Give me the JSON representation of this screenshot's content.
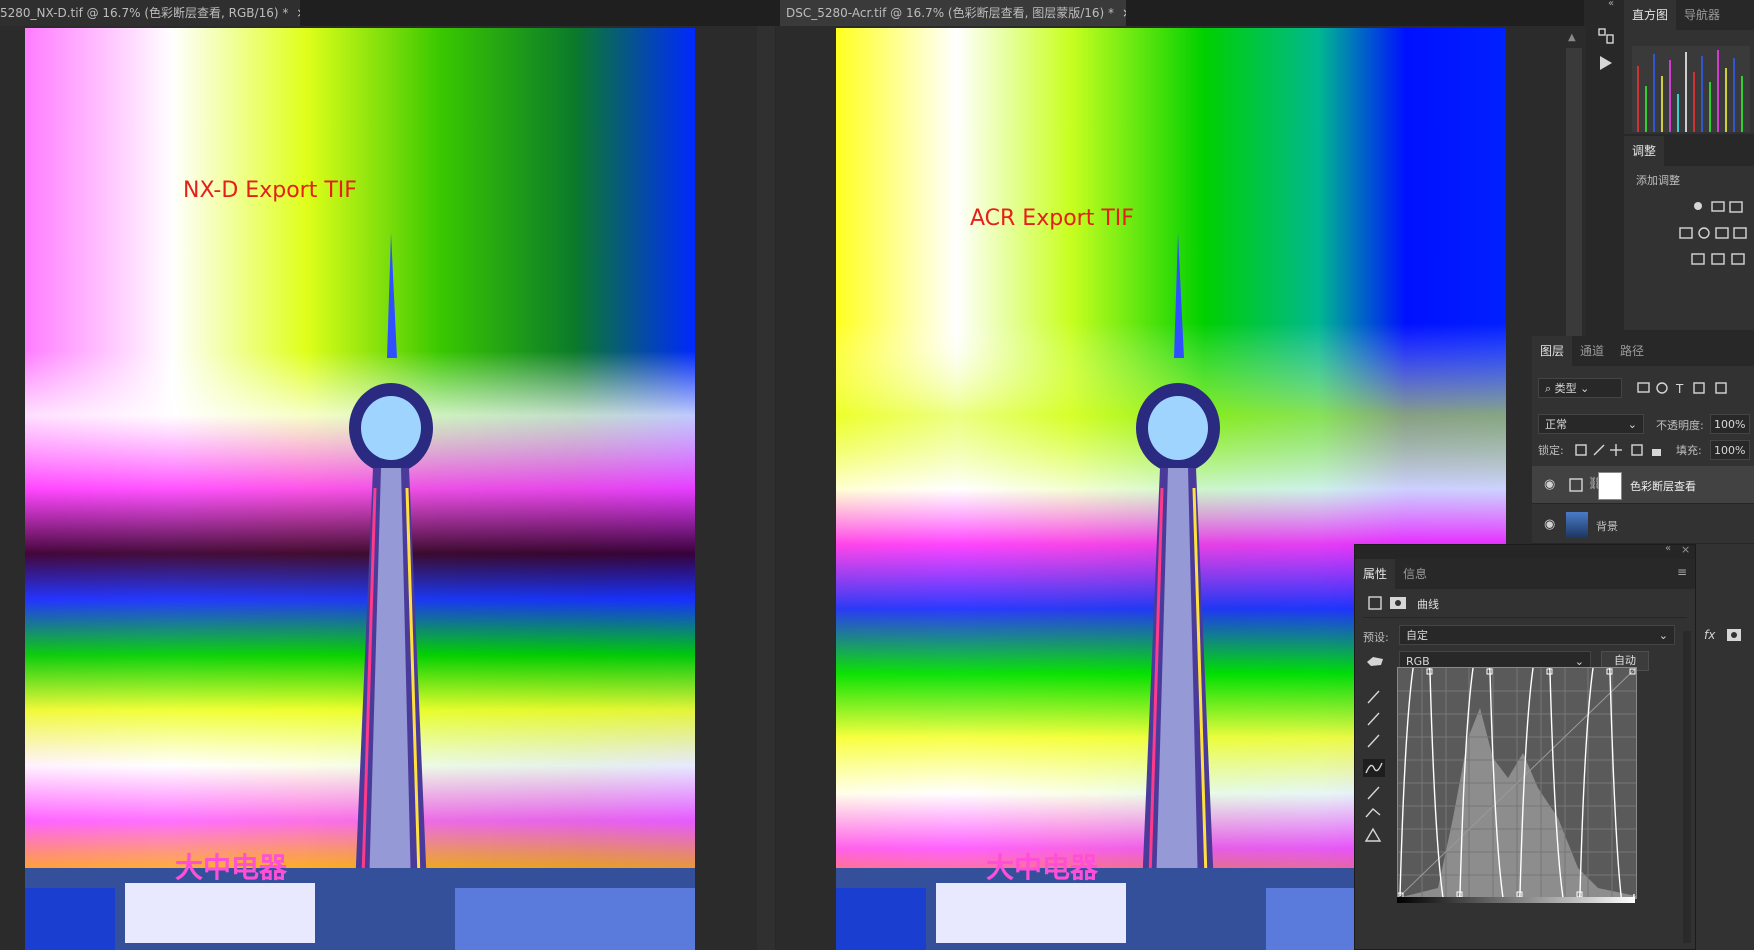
{
  "tabs": [
    {
      "title": "5280_NX-D.tif @ 16.7% (色彩断层查看, RGB/16) *",
      "close": "×"
    },
    {
      "title": "DSC_5280-Acr.tif @ 16.7% (色彩断层查看, 图层蒙版/16) *",
      "close": "×"
    }
  ],
  "canvases": [
    {
      "overlay_text": "NX-D Export TIF",
      "sign_text": "大中电器"
    },
    {
      "overlay_text": "ACR Export TIF",
      "sign_text": "大中电器"
    }
  ],
  "top_panels": {
    "tabs": [
      "直方图",
      "导航器"
    ],
    "adjust_tab": "调整",
    "add_adjust": "添加调整"
  },
  "layers_panel": {
    "tabs": [
      "图层",
      "通道",
      "路径"
    ],
    "filter_kind": "类型",
    "blend_mode": "正常",
    "opacity_label": "不透明度:",
    "opacity_value": "100%",
    "lock_label": "锁定:",
    "fill_label": "填充:",
    "fill_value": "100%",
    "layers": [
      {
        "name": "色彩断层查看",
        "selected": true
      },
      {
        "name": "背景",
        "selected": false
      }
    ]
  },
  "properties_panel": {
    "tabs": [
      "属性",
      "信息"
    ],
    "type_label": "曲线",
    "preset_label": "预设:",
    "preset_value": "自定",
    "channel_value": "RGB",
    "auto_button": "自动"
  },
  "colors": {
    "overlay_red": "#e5201a",
    "panel_bg": "#323232",
    "canvas_bg": "#2b2b2b"
  }
}
